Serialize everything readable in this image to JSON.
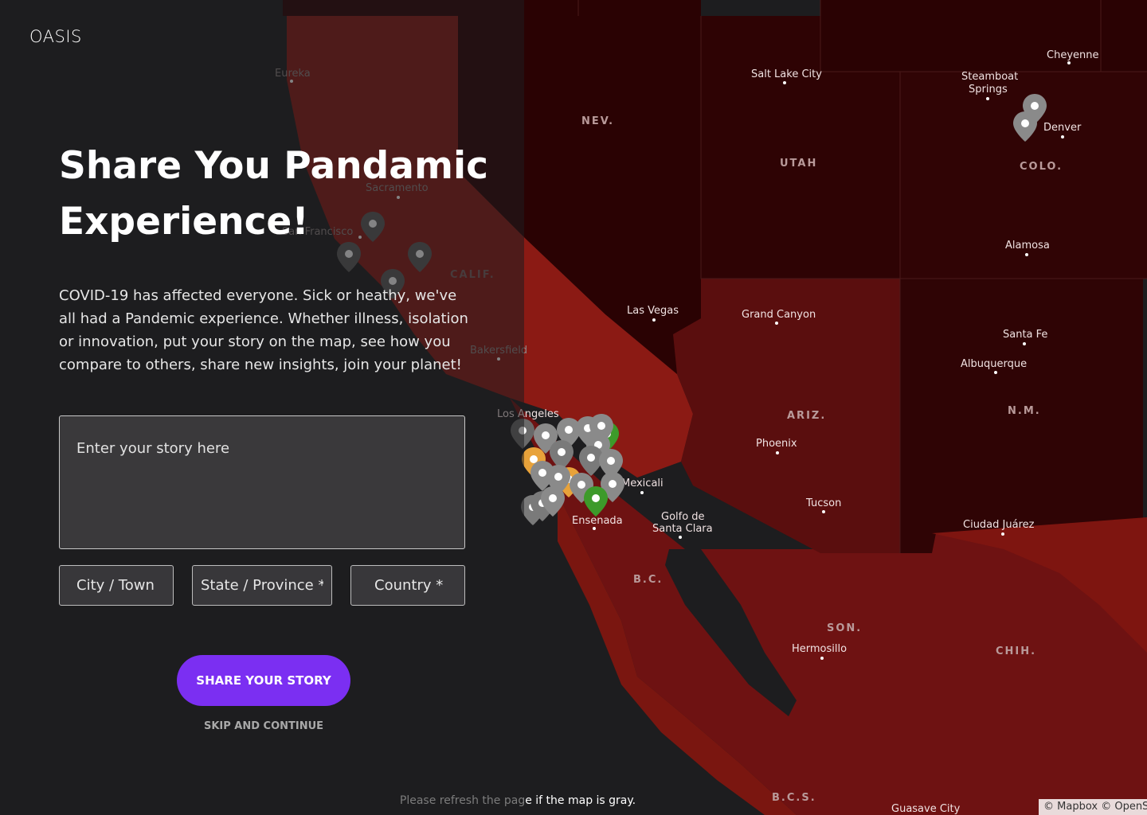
{
  "app": {
    "logo": "OASIS"
  },
  "hero": {
    "headline": "Share You Pandamic Experience!",
    "intro": "COVID-19 has affected everyone. Sick or heathy, we've all had a Pandemic experience. Whether illness, isolation or innovation, put your story on the map, see how you compare to others, share new insights, join your planet!"
  },
  "form": {
    "story_placeholder": "Enter your story here",
    "city_placeholder": "City / Town",
    "state_placeholder": "State / Province *",
    "country_placeholder": "Country *",
    "submit_label": "SHARE YOUR STORY",
    "skip_label": "SKIP AND CONTINUE"
  },
  "footer": {
    "refresh_note_faded": "Please refresh the pag",
    "refresh_note_rest": "e if the map is gray.",
    "attribution": "© Mapbox © OpenS"
  },
  "map": {
    "cities": [
      "Eureka",
      "Sacramento",
      "San Francisco",
      "Bakersfield",
      "Los Angeles",
      "Las Vegas",
      "Salt Lake City",
      "Cheyenne",
      "Steamboat",
      "Springs",
      "Denver",
      "Alamosa",
      "Grand Canyon",
      "Santa Fe",
      "Albuquerque",
      "Phoenix",
      "Tucson",
      "Mexicali",
      "Ensenada",
      "Golfo de",
      "Santa Clara",
      "Ciudad Juárez",
      "Hermosillo",
      "Guasave City"
    ],
    "states": [
      "NEV.",
      "UTAH",
      "COLO.",
      "CALIF.",
      "ARIZ.",
      "N.M.",
      "B.C.",
      "SON.",
      "CHIH.",
      "B.C.S."
    ],
    "colors": {
      "water": "#1d1d1f",
      "low": "#2a0203",
      "mid": "#3d0a0a",
      "high": "#6e1212",
      "highest": "#8b1a14",
      "pin_gray": "#8a8a8a",
      "pin_orange": "#e8a23a",
      "pin_green": "#3d9a2a",
      "accent": "#7b2ff2"
    }
  }
}
